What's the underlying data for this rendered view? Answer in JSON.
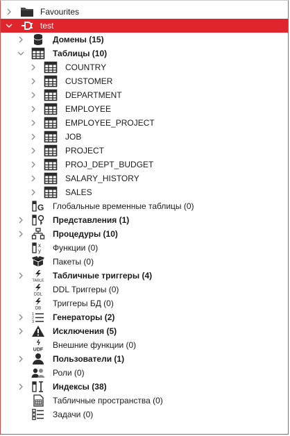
{
  "tree": {
    "favourites": {
      "label": "Favourites"
    },
    "connection": {
      "label": "test"
    },
    "domains": {
      "label": "Домены (15)"
    },
    "tables": {
      "label": "Таблицы (10)",
      "items": [
        "COUNTRY",
        "CUSTOMER",
        "DEPARTMENT",
        "EMPLOYEE",
        "EMPLOYEE_PROJECT",
        "JOB",
        "PROJECT",
        "PROJ_DEPT_BUDGET",
        "SALARY_HISTORY",
        "SALES"
      ]
    },
    "global_temp_tables": {
      "label": "Глобальные временные таблицы (0)"
    },
    "views": {
      "label": "Представления (1)"
    },
    "procedures": {
      "label": "Процедуры (10)"
    },
    "functions": {
      "label": "Функции (0)"
    },
    "packages": {
      "label": "Пакеты (0)"
    },
    "table_triggers": {
      "label": "Табличные триггеры (4)"
    },
    "ddl_triggers": {
      "label": "DDL Триггеры (0)"
    },
    "db_triggers": {
      "label": "Триггеры БД (0)"
    },
    "generators": {
      "label": "Генераторы (2)"
    },
    "exceptions": {
      "label": "Исключения (5)"
    },
    "external_functions": {
      "label": "Внешние функции (0)"
    },
    "users": {
      "label": "Пользователи (1)"
    },
    "roles": {
      "label": "Роли (0)"
    },
    "indexes": {
      "label": "Индексы (38)"
    },
    "tablespaces": {
      "label": "Табличные пространства (0)"
    },
    "jobs": {
      "label": "Задачи (0)"
    }
  },
  "icons": {
    "favourites": "folder-icon",
    "connection": "plug-icon",
    "domains": "database-cylinder-icon",
    "tables": "table-icon",
    "global_temp_tables": "global-temp-table-icon",
    "views": "view-icon",
    "procedures": "procedure-icon",
    "functions": "function-icon",
    "packages": "package-icon",
    "table_triggers": "table-trigger-icon",
    "ddl_triggers": "ddl-trigger-icon",
    "db_triggers": "db-trigger-icon",
    "generators": "generator-icon",
    "exceptions": "warning-icon",
    "external_functions": "udf-icon",
    "users": "user-icon",
    "roles": "roles-icon",
    "indexes": "index-icon",
    "tablespaces": "tablespace-icon",
    "jobs": "jobs-icon"
  },
  "colors": {
    "selection": "#e0262c"
  }
}
